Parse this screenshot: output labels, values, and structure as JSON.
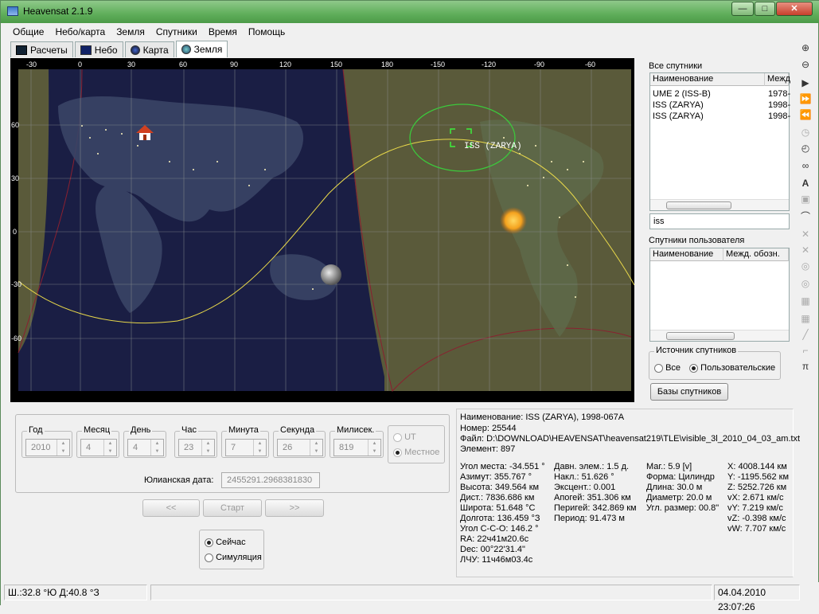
{
  "window": {
    "title": "Heavensat 2.1.9",
    "controls": [
      "—",
      "□",
      "✕"
    ]
  },
  "menu": [
    "Общие",
    "Небо/карта",
    "Земля",
    "Спутники",
    "Время",
    "Помощь"
  ],
  "tabs": [
    {
      "label": "Расчеты",
      "icon": "calc-icon"
    },
    {
      "label": "Небо",
      "icon": "sky-icon"
    },
    {
      "label": "Карта",
      "icon": "map-icon"
    },
    {
      "label": "Земля",
      "icon": "globe-icon",
      "active": true
    }
  ],
  "map": {
    "lon_ticks": [
      "-30",
      "0",
      "30",
      "60",
      "90",
      "120",
      "150",
      "180",
      "-150",
      "-120",
      "-90",
      "-60"
    ],
    "lat_ticks": [
      "60",
      "30",
      "0",
      "-30",
      "-60"
    ],
    "satellite_label": "ISS (ZARYA)",
    "colors": {
      "track": "#e8d84a",
      "footprint": "#3cc83c",
      "terminator": "#c83c3c",
      "sun": "#f4a21e"
    }
  },
  "all_sats": {
    "title": "Все спутники",
    "columns": [
      "Наименование",
      "Межд"
    ],
    "rows": [
      {
        "name": "UME 2 (ISS-B)",
        "id": "1978-"
      },
      {
        "name": "ISS (ZARYA)",
        "id": "1998-"
      },
      {
        "name": "ISS (ZARYA)",
        "id": "1998-"
      }
    ]
  },
  "search": {
    "value": "iss"
  },
  "user_sats": {
    "title": "Спутники пользователя",
    "columns": [
      "Наименование",
      "Межд. обозн."
    ]
  },
  "source": {
    "title": "Источник спутников",
    "options": [
      "Все",
      "Пользовательские"
    ],
    "selected": "Пользовательские"
  },
  "db_button": "Базы спутников",
  "time": {
    "fields": [
      {
        "label": "Год",
        "value": "2010"
      },
      {
        "label": "Месяц",
        "value": "4"
      },
      {
        "label": "День",
        "value": "4"
      },
      {
        "label": "Час",
        "value": "23"
      },
      {
        "label": "Минута",
        "value": "7"
      },
      {
        "label": "Секунда",
        "value": "26"
      },
      {
        "label": "Милисек.",
        "value": "819"
      }
    ],
    "zone_options": [
      "UT",
      "Местное"
    ],
    "zone_selected": "Местное",
    "julian_label": "Юлианская дата:",
    "julian_value": "2455291.2968381830",
    "prev": "<<",
    "start": "Старт",
    "next": ">>",
    "mode_options": [
      "Сейчас",
      "Симуляция"
    ],
    "mode_selected": "Сейчас"
  },
  "info": {
    "header": [
      "Наименование: ISS (ZARYA),  1998-067A",
      "Номер: 25544",
      "Файл: D:\\DOWNLOAD\\HEAVENSAT\\heavensat219\\TLE\\visible_3l_2010_04_03_am.txt",
      "Элемент: 897"
    ],
    "col1": [
      "Угол места: -34.551 °",
      "Азимут: 355.767 °",
      "Высота: 349.564 км",
      "Дист.: 7836.686 км",
      "Широта: 51.648 °С",
      "Долгота: 136.459 °З",
      "Угол С-С-О: 146.2 °",
      "RA: 22ч41м20.6с",
      "Dec: 00°22'31.4\"",
      "ЛЧУ: 11ч46м03.4с"
    ],
    "col2": [
      "Давн. элем.: 1.5 д.",
      "Накл.: 51.626 °",
      "Эксцент.: 0.001",
      "Апогей: 351.306 км",
      "Перигей: 342.869 км",
      "Период: 91.473 м"
    ],
    "col3": [
      "Маг.: 5.9 [v]",
      "Форма: Цилиндр",
      "Длина: 30.0 м",
      "Диаметр: 20.0 м",
      "Угл. размер: 00.8\""
    ],
    "col4": [
      "X: 4008.144 км",
      "Y: -1195.562 км",
      "Z: 5252.726 км",
      "vX: 2.671 км/с",
      "vY: 7.219 км/с",
      "vZ: -0.398 км/с",
      "vW: 7.707 км/с"
    ]
  },
  "status": {
    "coords": "Ш.:32.8 °Ю Д:40.8 °З",
    "middle": "",
    "datetime": "04.04.2010 23:07:26"
  }
}
